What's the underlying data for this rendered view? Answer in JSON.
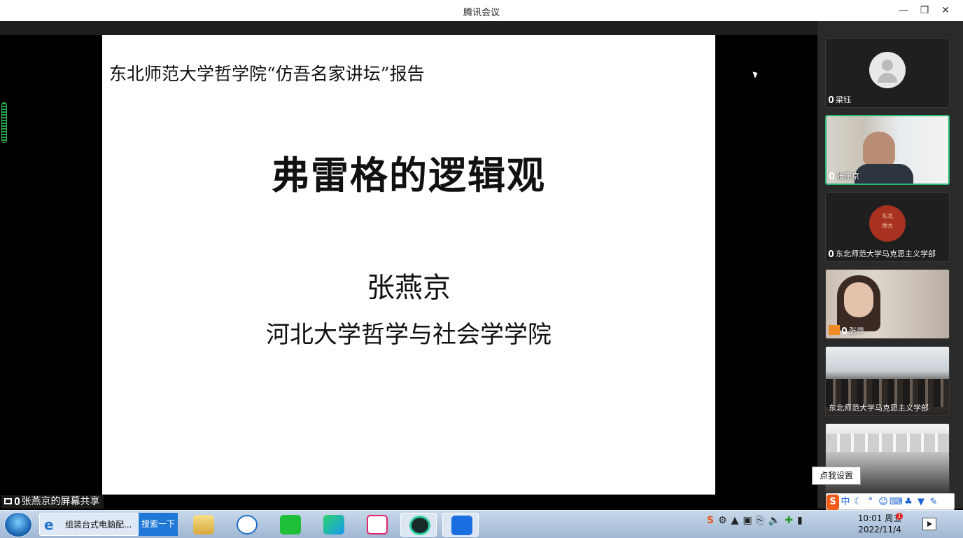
{
  "window": {
    "title": "腾讯会议"
  },
  "slide": {
    "header": "东北师范大学哲学院“仿吾名家讲坛”报告",
    "title": "弗雷格的逻辑观",
    "author": "张燕京",
    "affiliation": "河北大学哲学与社会学学院"
  },
  "participants": [
    {
      "name": "梁钰",
      "video": "avatar-placeholder"
    },
    {
      "name": "张燕京",
      "video": "camera",
      "active": true
    },
    {
      "name": "东北师范大学马克思主义学部",
      "video": "logo-seal"
    },
    {
      "name": "张萍",
      "video": "camera"
    },
    {
      "name": "东北师范大学马克思主义学部",
      "video": "camera-classroom"
    }
  ],
  "seal_text": "东北\n师大",
  "tooltip": "点我设置",
  "screen_share_label": "张燕京的屏幕共享",
  "ime": {
    "mode": "中"
  },
  "taskbar": {
    "ie_item": "组装台式电脑配...",
    "search_button": "搜索一下"
  },
  "clock": {
    "time": "10:01 周五",
    "date": "2022/11/4",
    "notification_count": "1"
  },
  "colors": {
    "active_border": "#2bb673",
    "accent_blue": "#1f78d6",
    "slide_bg": "#ffffff"
  }
}
